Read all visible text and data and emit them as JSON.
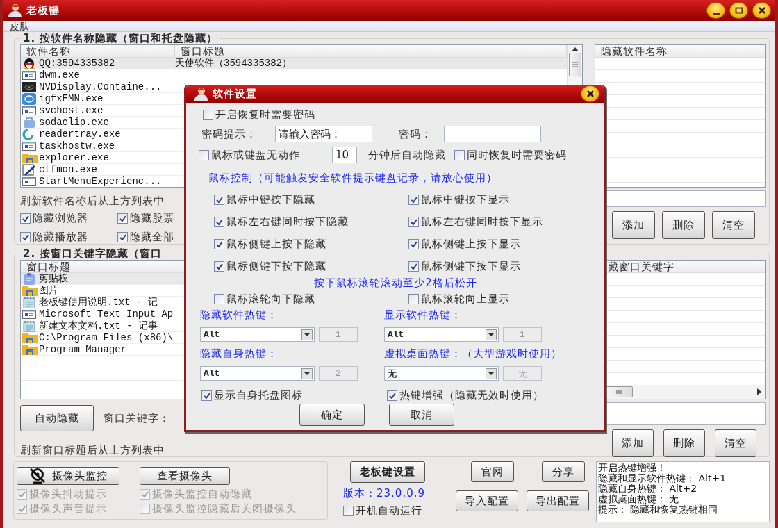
{
  "window": {
    "title": "老板键"
  },
  "menu": [
    "皮肤"
  ],
  "section1": {
    "title": "1. 按软件名称隐藏（窗口和托盘隐藏）",
    "columns": [
      "软件名称",
      "窗口标题"
    ],
    "rows": [
      {
        "kind": "penguin",
        "name": "QQ:3594335382",
        "window_title": "天使软件（3594335382）",
        "selected": true
      },
      {
        "kind": "app",
        "name": "dwm.exe",
        "selected": false
      },
      {
        "kind": "dark",
        "name": "NVDisplay.Containe...",
        "selected": false
      },
      {
        "kind": "badge",
        "name": "igfxEMN.exe",
        "selected": false
      },
      {
        "kind": "app",
        "name": "svchost.exe",
        "selected": false
      },
      {
        "kind": "bag",
        "name": "sodaclip.exe",
        "selected": false
      },
      {
        "kind": "ring",
        "name": "readertray.exe",
        "selected": false
      },
      {
        "kind": "app",
        "name": "taskhostw.exe",
        "selected": false
      },
      {
        "kind": "folder",
        "name": "explorer.exe",
        "selected": false
      },
      {
        "kind": "pencil",
        "name": "ctfmon.exe",
        "selected": false
      },
      {
        "kind": "app",
        "name": "StartMenuExperienc...",
        "selected": false
      }
    ],
    "hidden_list_header": "隐藏软件名称",
    "note": "刷新软件名称后从上方列表中",
    "checks": [
      {
        "label": "隐藏浏览器",
        "checked": true
      },
      {
        "label": "隐藏股票",
        "checked": true
      },
      {
        "label": "隐藏播放器",
        "checked": true
      },
      {
        "label": "隐藏全部",
        "checked": true
      }
    ],
    "buttons": [
      "添加",
      "删除",
      "清空"
    ]
  },
  "section2": {
    "title": "2. 按窗口关键字隐藏（窗口",
    "column": "窗口标题",
    "rows": [
      {
        "kind": "clipboard",
        "title": "剪贴板",
        "selected": true
      },
      {
        "kind": "folder",
        "title": "图片",
        "selected": false
      },
      {
        "kind": "notepad",
        "title": "老板键使用说明.txt - 记",
        "selected": false
      },
      {
        "kind": "app",
        "title": "Microsoft Text Input Ap",
        "selected": false
      },
      {
        "kind": "notepad",
        "title": "新建文本文档.txt - 记事",
        "selected": false
      },
      {
        "kind": "folder",
        "title": "C:\\Program Files (x86)\\",
        "selected": false
      },
      {
        "kind": "folder",
        "title": "Program Manager",
        "selected": false
      }
    ],
    "keyword_list_header": "藏窗口关键字",
    "auto_hide_button": "自动隐藏",
    "keyword_label": "窗口关键字：",
    "note": "刷新窗口标题后从上方列表中",
    "buttons": [
      "添加",
      "删除",
      "清空"
    ]
  },
  "camera": {
    "monitor_button": "摄像头监控",
    "view_button": "查看摄像头",
    "checks": [
      {
        "label": "摄像头抖动提示",
        "checked": true,
        "disabled": true
      },
      {
        "label": "摄像头监控自动隐藏",
        "checked": true,
        "disabled": true
      },
      {
        "label": "摄像头声音提示",
        "checked": true,
        "disabled": true
      },
      {
        "label": "摄像头监控隐藏后关闭摄像头",
        "checked": false,
        "disabled": true
      }
    ]
  },
  "settings_button": "老板键设置",
  "version": "版本：23.0.0.9",
  "autostart": {
    "label": "开机自动运行",
    "checked": false
  },
  "links": [
    "官网",
    "分享",
    "导入配置",
    "导出配置"
  ],
  "log": [
    "开启热键增强！",
    "隐藏和显示软件热键： Alt+1",
    "隐藏自身热键： Alt+2",
    "虚拟桌面热键： 无",
    "提示： 隐藏和恢复热键相同"
  ],
  "dialog": {
    "title": "软件设置",
    "require_password": {
      "label": "开启恢复时需要密码",
      "checked": false
    },
    "password_hint": {
      "label": "密码提示：",
      "value": "请输入密码："
    },
    "password": {
      "label": "密码："
    },
    "idle": {
      "label": "鼠标或键盘无动作",
      "checked": false,
      "minutes": "10",
      "suffix": "分钟后自动隐藏"
    },
    "idle_password": {
      "label": "同时恢复时需要密码",
      "checked": false
    },
    "mouse_heading": "鼠标控制（可能触发安全软件提示键盘记录，请放心使用）",
    "mouse_options": [
      {
        "label": "鼠标中键按下隐藏",
        "checked": true
      },
      {
        "label": "鼠标中键按下显示",
        "checked": true
      },
      {
        "label": "鼠标左右键同时按下隐藏",
        "checked": true
      },
      {
        "label": "鼠标左右键同时按下显示",
        "checked": true
      },
      {
        "label": "鼠标侧键上按下隐藏",
        "checked": true
      },
      {
        "label": "鼠标侧键上按下显示",
        "checked": true
      },
      {
        "label": "鼠标侧键下按下隐藏",
        "checked": true
      },
      {
        "label": "鼠标侧键下按下显示",
        "checked": true
      }
    ],
    "wheel_note": "按下鼠标滚轮滚动至少2格后松开",
    "wheel_options": [
      {
        "label": "鼠标滚轮向下隐藏",
        "checked": false
      },
      {
        "label": "鼠标滚轮向上显示",
        "checked": false
      }
    ],
    "hotkeys": [
      {
        "label": "隐藏软件热键：",
        "modifier": "Alt",
        "key": "1",
        "key_disabled": true
      },
      {
        "label": "显示软件热键：",
        "modifier": "Alt",
        "key": "1",
        "key_disabled": true
      },
      {
        "label": "隐藏自身热键：",
        "modifier": "Alt",
        "key": "2",
        "key_disabled": true
      },
      {
        "label": "虚拟桌面热键：（大型游戏时使用）",
        "modifier": "无",
        "key": "无",
        "key_disabled": true
      }
    ],
    "tray_checks": [
      {
        "label": "显示自身托盘图标",
        "checked": true
      },
      {
        "label": "热键增强（隐藏无效时使用）",
        "checked": true
      }
    ],
    "buttons": [
      "确定",
      "取消"
    ]
  }
}
